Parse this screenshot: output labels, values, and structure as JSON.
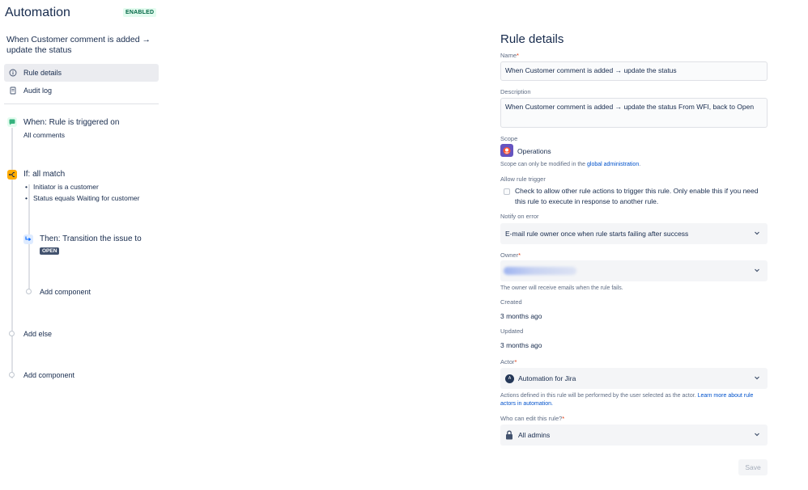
{
  "header": {
    "title": "Automation",
    "status_badge": "ENABLED",
    "rule_name": "When Customer comment is added → update the status"
  },
  "nav": {
    "items": [
      {
        "label": "Rule details",
        "icon": "info-icon"
      },
      {
        "label": "Audit log",
        "icon": "document-icon"
      }
    ]
  },
  "flow": {
    "trigger": {
      "title": "When: Rule is triggered on",
      "subtitle": "All comments",
      "icon": "speech-bubble-icon"
    },
    "condition": {
      "title": "If: all match",
      "items": [
        "Initiator is a customer",
        "Status equals Waiting for customer"
      ],
      "icon": "branch-icon"
    },
    "action": {
      "title": "Then: Transition the issue to",
      "status": "OPEN",
      "icon": "transition-icon"
    },
    "add_component_inner": "Add component",
    "add_else": "Add else",
    "add_component_outer": "Add component"
  },
  "details": {
    "title": "Rule details",
    "name_label": "Name",
    "name_value": "When Customer comment is added → update the status",
    "description_label": "Description",
    "description_value": "When Customer comment is added → update the status From WFI, back to Open",
    "scope_label": "Scope",
    "scope_value": "Operations",
    "scope_help_prefix": "Scope can only be modified in the ",
    "scope_help_link": "global administration",
    "scope_help_suffix": ".",
    "allow_trigger_label": "Allow rule trigger",
    "allow_trigger_text": "Check to allow other rule actions to trigger this rule. Only enable this if you need this rule to execute in response to another rule.",
    "notify_label": "Notify on error",
    "notify_value": "E-mail rule owner once when rule starts failing after success",
    "owner_label": "Owner",
    "owner_help": "The owner will receive emails when the rule fails.",
    "created_label": "Created",
    "created_value": "3 months ago",
    "updated_label": "Updated",
    "updated_value": "3 months ago",
    "actor_label": "Actor",
    "actor_value": "Automation for Jira",
    "actor_help": "Actions defined in this rule will be performed by the user selected as the actor. ",
    "actor_help_link": "Learn more about rule actors in automation.",
    "editors_label": "Who can edit this rule?",
    "editors_value": "All admins",
    "save_label": "Save",
    "required_mark": "*"
  },
  "colors": {
    "enabled_badge_bg": "#e3fcef",
    "enabled_badge_text": "#006644",
    "trigger_icon": "#36b37e",
    "condition_icon": "#ffab00",
    "action_icon": "#0065ff",
    "link": "#0052cc",
    "scope_icon": "#6554c0"
  }
}
